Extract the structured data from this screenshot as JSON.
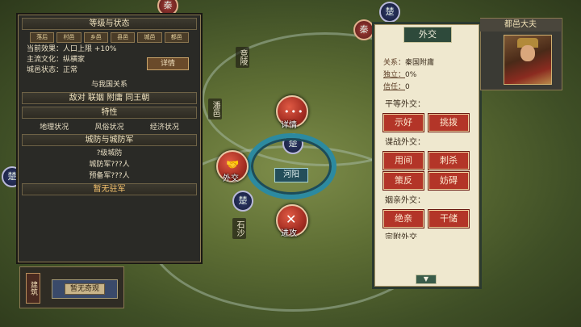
{
  "map": {
    "labels": [
      "竞陵",
      "潘邑",
      "石沙"
    ],
    "markers": [
      {
        "glyph": "秦",
        "type": "enemy"
      },
      {
        "glyph": "楚",
        "type": "ally"
      },
      {
        "glyph": "楚",
        "type": "ally"
      },
      {
        "glyph": "楚",
        "type": "ally"
      },
      {
        "glyph": "秦",
        "type": "enemy"
      },
      {
        "glyph": "楚",
        "type": "ally"
      }
    ],
    "river_name": "河阳"
  },
  "left_panel": {
    "header_level": "等级与状态",
    "chips": [
      "落后",
      "村邑",
      "乡邑",
      "县邑",
      "城邑",
      "都邑"
    ],
    "effect_label": "当前效果：",
    "effect_value": "人口上限 +10%",
    "culture_label": "主流文化：",
    "culture_value": "纵横家",
    "state_label": "城邑状态：",
    "state_value": "正常",
    "detail_button": "详情",
    "relations_title": "与我国关系",
    "relations_line": "敌对  联姻  附庸  同王朝",
    "traits_header": "特性",
    "traits": [
      "地理状况",
      "风俗状况",
      "经济状况"
    ],
    "defense_header": "城防与城防军",
    "defense_lines": [
      "?级城防",
      "城防军???人",
      "预备军???人"
    ],
    "garrison_header": "暂无驻军"
  },
  "actions": {
    "detail": "详情",
    "diplomacy": "外交",
    "attack": "进攻"
  },
  "diplomacy_panel": {
    "title": "外交",
    "relation_label": "关系：",
    "relation_value": "秦国附庸",
    "independence_label": "独立：",
    "independence_value": "0%",
    "trust_label": "信任：",
    "trust_value": "0",
    "equal_header": "平等外交：",
    "equal_buttons": [
      "示好",
      "挑拨"
    ],
    "spy_header": "谍战外交：",
    "spy_buttons": [
      "用间",
      "刺杀",
      "策反",
      "妨碍"
    ],
    "marriage_header": "姻亲外交：",
    "marriage_buttons": [
      "绝亲",
      "干储"
    ],
    "next_header_partial": "宗附外交"
  },
  "general_panel": {
    "title": "都邑大夫"
  },
  "bottom_bar": {
    "build_tab": "建筑",
    "empty_build": "暂无奇观"
  }
}
